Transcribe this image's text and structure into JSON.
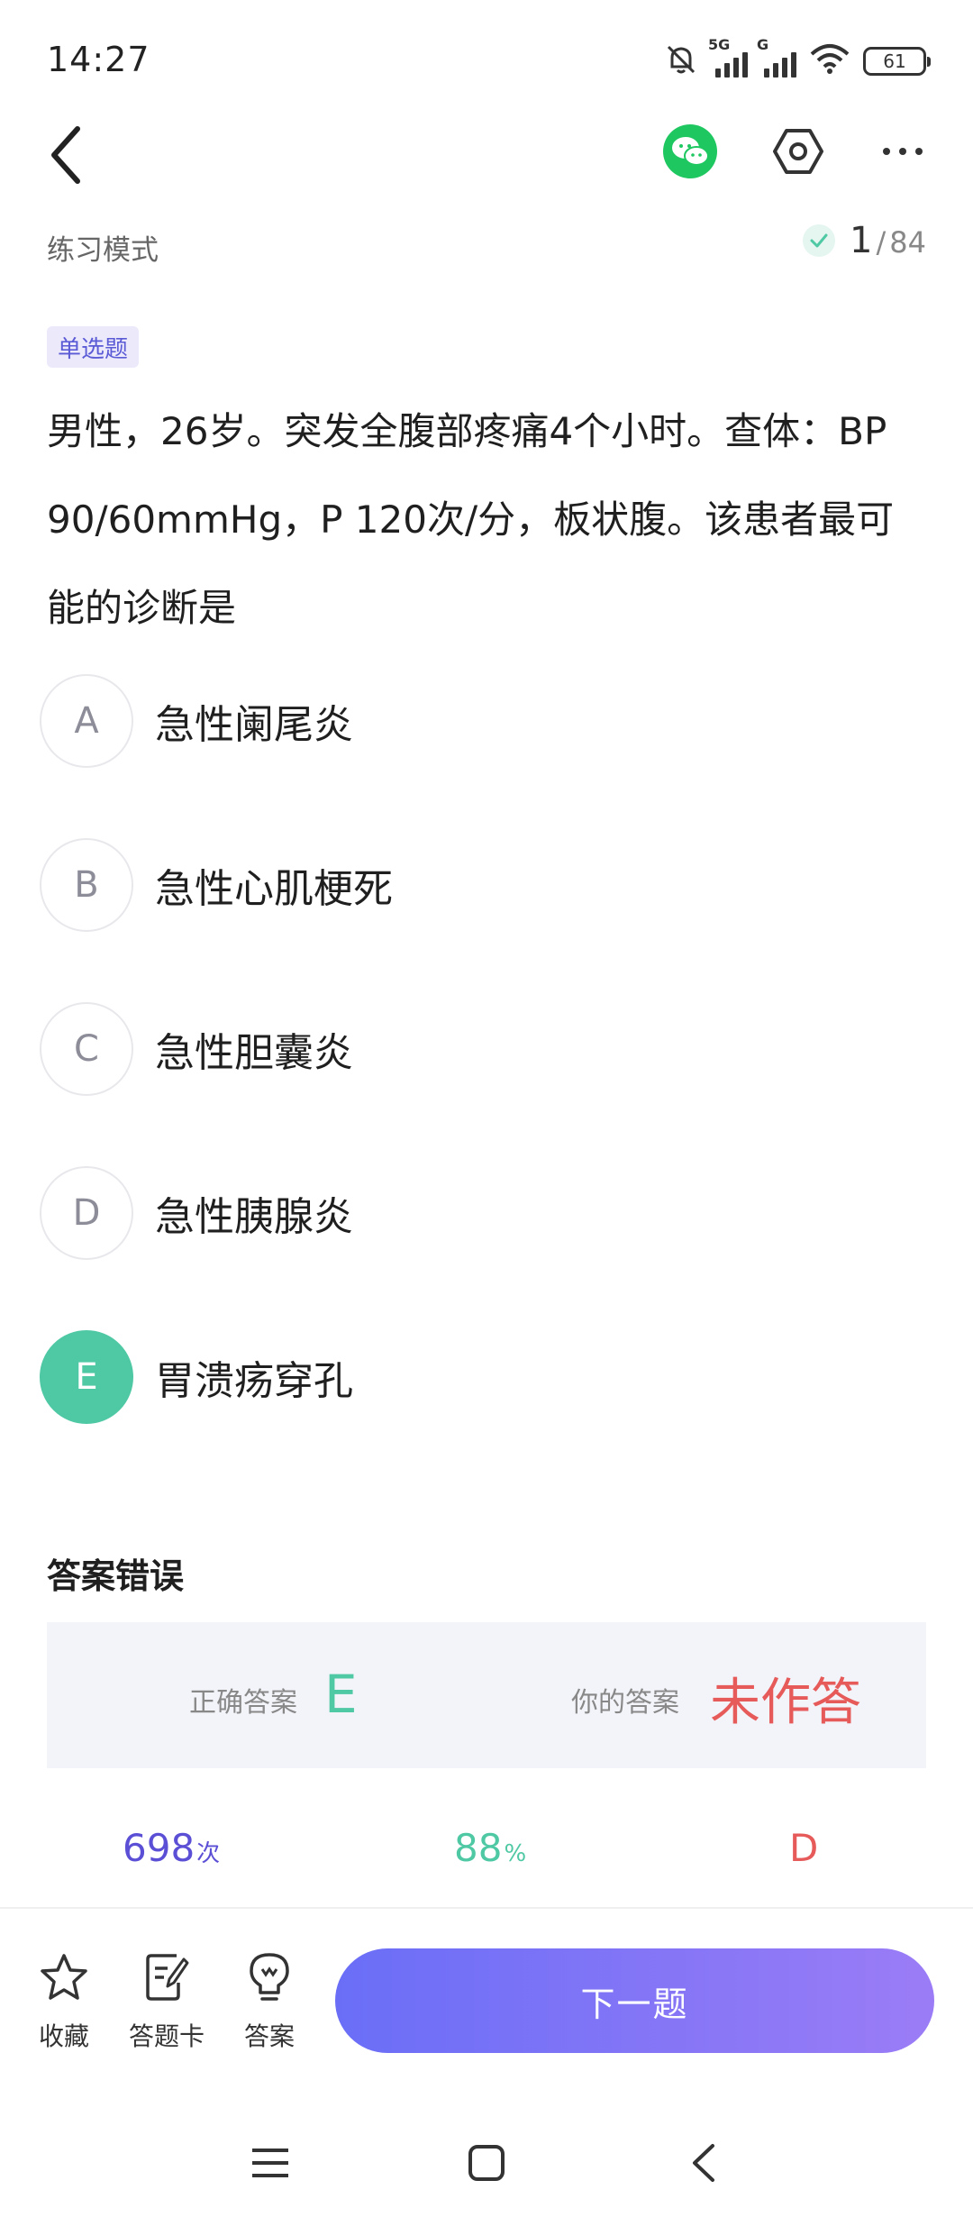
{
  "status_bar": {
    "time": "14:27",
    "signal1_label": "5G",
    "signal2_label": "G",
    "battery": "61"
  },
  "header": {
    "icons": [
      "back-arrow-icon",
      "wechat-icon",
      "hexagon-settings-icon",
      "more-dots-icon"
    ],
    "wechat_color": "#1ec760"
  },
  "mode": {
    "label": "练习模式",
    "current": "1",
    "separator": "/",
    "total": "84"
  },
  "question": {
    "type": "单选题",
    "text": "男性，26岁。突发全腹部疼痛4个小时。查体：BP 90/60mmHg，P 120次/分，板状腹。该患者最可能的诊断是",
    "options": [
      {
        "letter": "A",
        "text": "急性阑尾炎"
      },
      {
        "letter": "B",
        "text": "急性心肌梗死"
      },
      {
        "letter": "C",
        "text": "急性胆囊炎"
      },
      {
        "letter": "D",
        "text": "急性胰腺炎"
      },
      {
        "letter": "E",
        "text": "胃溃疡穿孔"
      }
    ],
    "correct_letter": "E"
  },
  "result": {
    "title": "答案错误",
    "correct_label": "正确答案",
    "correct_value": "E",
    "yours_label": "你的答案",
    "yours_value": "未作答"
  },
  "stats": {
    "count": "698",
    "count_unit": "次",
    "rate": "88",
    "rate_unit": "%",
    "common_wrong": "D"
  },
  "bottom_bar": {
    "favorite_label": "收藏",
    "answer_card_label": "答题卡",
    "answer_label": "答案",
    "next_label": "下一题"
  },
  "colors": {
    "accent_purple": "#6a6ef7",
    "correct_green": "#4fc8a4",
    "wrong_red": "#e65a5a"
  }
}
